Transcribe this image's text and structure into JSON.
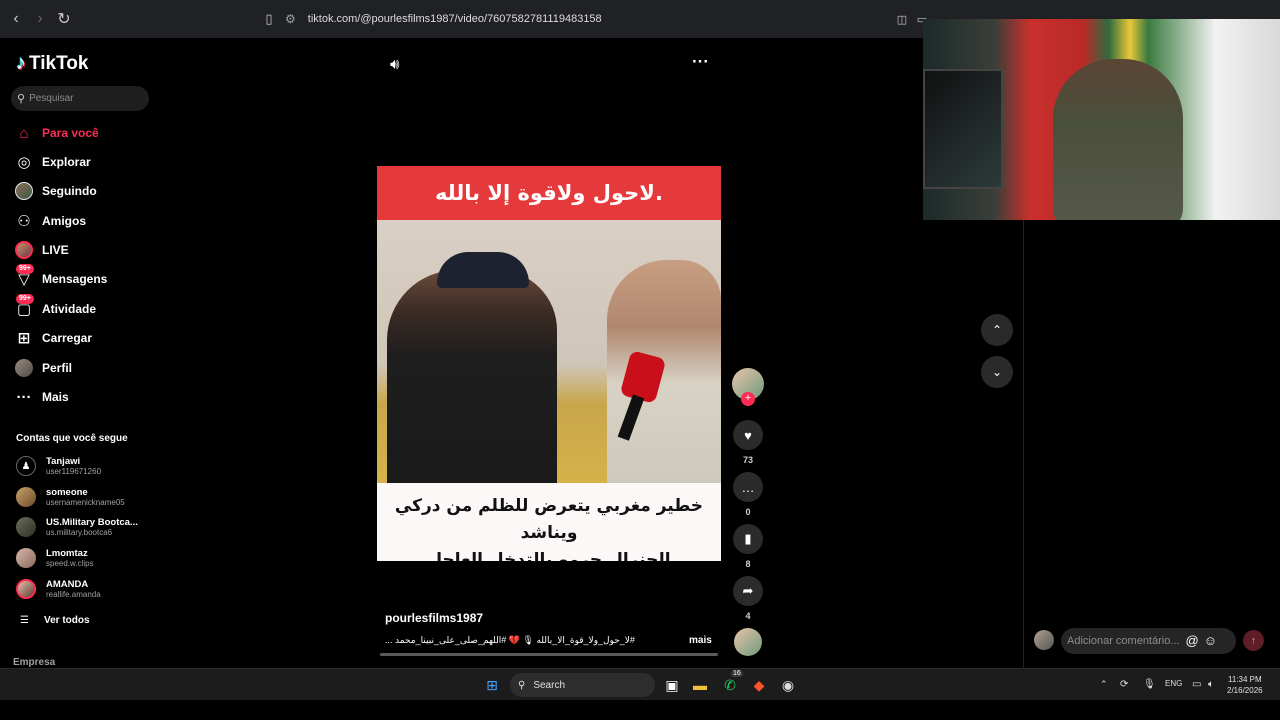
{
  "browser": {
    "url": "tiktok.com/@pourlesfilms1987/video/7607582781119483158",
    "back_icon": "chevron-left-icon",
    "forward_icon": "chevron-right-icon",
    "reload_icon": "reload-icon"
  },
  "sidebar": {
    "logo": "TikTok",
    "search_placeholder": "Pesquisar",
    "menu": [
      {
        "label": "Para você",
        "icon": "home-icon",
        "active": true
      },
      {
        "label": "Explorar",
        "icon": "compass-icon"
      },
      {
        "label": "Seguindo",
        "icon": "avatar-icon"
      },
      {
        "label": "Amigos",
        "icon": "friends-icon"
      },
      {
        "label": "LIVE",
        "icon": "live-icon"
      },
      {
        "label": "Mensagens",
        "icon": "message-icon",
        "badge": "99+"
      },
      {
        "label": "Atividade",
        "icon": "activity-icon",
        "badge": "99+"
      },
      {
        "label": "Carregar",
        "icon": "upload-icon"
      },
      {
        "label": "Perfil",
        "icon": "profile-icon"
      },
      {
        "label": "Mais",
        "icon": "more-icon"
      }
    ],
    "following_title": "Contas que você segue",
    "following": [
      {
        "name": "Tanjawi",
        "user": "user119671260"
      },
      {
        "name": "someone",
        "user": "usernamenickname05"
      },
      {
        "name": "US.Military Bootca...",
        "user": "us.military.bootca6"
      },
      {
        "name": "Lmomtaz",
        "user": "speed.w.clips"
      },
      {
        "name": "AMANDA",
        "user": "reallife.amanda"
      }
    ],
    "see_all": "Ver todos",
    "footer": "Empresa"
  },
  "video": {
    "top_text": "لاحول ولاقوة إلا بالله.",
    "bottom_text_1": "خطير مغربي يتعرض للظلم من دركي ويناشد",
    "bottom_text_2": "الجنرال حرمو بالتدخل العاجل",
    "author": "pourlesfilms1987",
    "description": "#لا_حول_ولا_قوة_الا_بالله 🎙 💔 #اللهم_صلى_على_نبينا_محمد ...",
    "more": "mais",
    "likes": "73",
    "comments": "0",
    "saves": "8",
    "shares": "4",
    "volume_icon": "volume-icon",
    "options_icon": "more-options-icon"
  },
  "comment": {
    "placeholder": "Adicionar comentário..."
  },
  "taskbar": {
    "search": "Search",
    "lang": "ENG",
    "time": "11:34 PM",
    "date": "2/16/2026",
    "whatsapp_badge": "16"
  },
  "colors": {
    "accent": "#fe2c55",
    "video_banner": "#e6393b"
  }
}
